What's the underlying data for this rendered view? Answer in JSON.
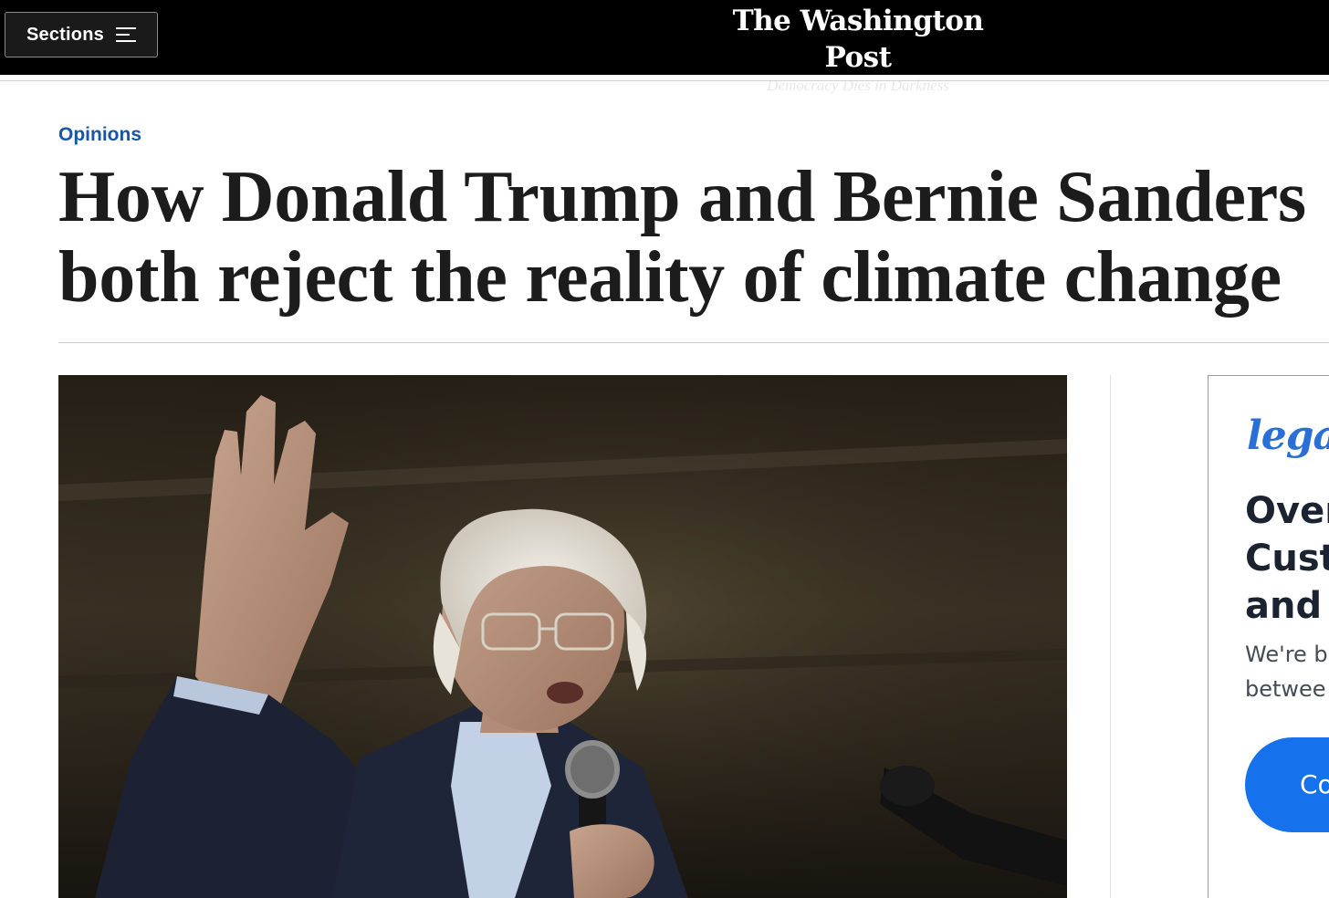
{
  "nav": {
    "sections_label": "Sections",
    "menu_icon": "hamburger-menu-icon",
    "masthead_title": "The Washington Post",
    "masthead_tagline": "Democracy Dies in Darkness"
  },
  "article": {
    "kicker": "Opinions",
    "headline_line1": "How Donald Trump and Bernie Sanders",
    "headline_line2": "both reject the reality of climate change"
  },
  "ad": {
    "logo": "legal",
    "headline_line1": "Over",
    "headline_line2": "Cust",
    "headline_line3": "and",
    "body_line1": "We're b",
    "body_line2": "betwee",
    "cta": "Co"
  },
  "colors": {
    "nav_background": "#000000",
    "kicker": "#1955a5",
    "headline": "#1c1c1c",
    "ad_logo": "#2a6fd6",
    "ad_cta": "#1671ec"
  }
}
